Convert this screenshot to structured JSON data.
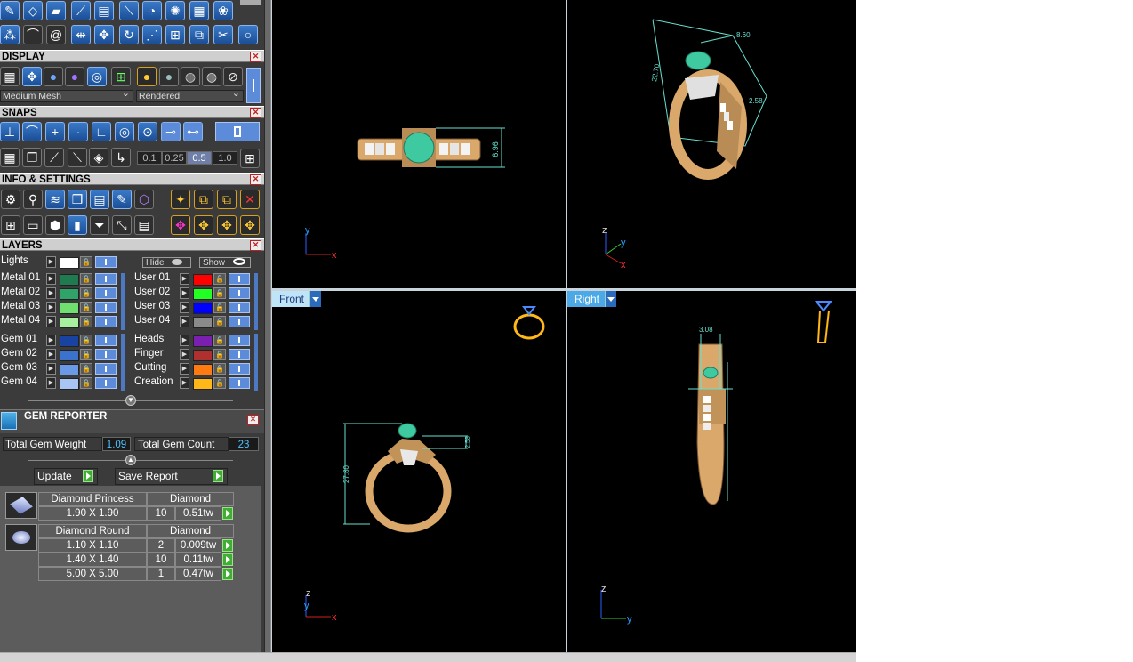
{
  "toolbar": {
    "row1_icons": [
      "sketch-icon",
      "gem-icon",
      "shape-icon",
      "sweep-icon",
      "document-icon",
      "cutter-icon",
      "bail-icon",
      "pave-icon",
      "grid-icon",
      "flower-icon"
    ],
    "row2_icons": [
      "cluster-icon",
      "curve-icon",
      "spiral-icon",
      "mirror-icon",
      "move-icon",
      "rotate-icon",
      "deform-icon",
      "link-icon",
      "split-icon",
      "scissors-icon",
      "circle-icon"
    ]
  },
  "display": {
    "title": "DISPLAY",
    "icons": [
      "wireframe-icon",
      "pin-icon",
      "sphere-blue-icon",
      "sphere-purple-icon",
      "globe-icon",
      "layout-icon",
      "sphere-gold-icon",
      "sphere-silver-icon",
      "sphere-chrome-icon",
      "sphere-glass-icon"
    ],
    "mesh_select": "Medium Mesh",
    "render_select": "Rendered"
  },
  "snaps": {
    "title": "SNAPS",
    "icons": [
      "end-snap-icon",
      "curve-snap-icon",
      "intersect-snap-icon",
      "point-snap-icon",
      "perp-snap-icon",
      "center-snap-icon",
      "circle-snap-icon",
      "mid-snap-icon",
      "near-snap-icon"
    ],
    "row2_icons": [
      "grid-snap-icon",
      "cube-snap-icon",
      "line-snap-icon",
      "ruler-icon",
      "eye-snap-icon",
      "axis-snap-icon"
    ],
    "values": [
      "0.1",
      "0.25",
      "0.5",
      "1.0"
    ],
    "selected_value": "0.5"
  },
  "info": {
    "title": "INFO & SETTINGS",
    "row1_icons": [
      "settings-icon",
      "search-icon",
      "layers-icon",
      "cube-icon",
      "script-icon",
      "edit-icon",
      "gem-info-icon",
      "magic-icon",
      "copy-icon",
      "paste-icon",
      "delete-icon"
    ],
    "row2_icons": [
      "windows-icon",
      "monitor-icon",
      "box-icon",
      "book-icon",
      "filter-icon",
      "measure-icon",
      "report-icon",
      "tool-a-icon",
      "tool-b-icon",
      "tool-c-icon",
      "tool-d-icon"
    ]
  },
  "layers": {
    "title": "LAYERS",
    "lights_label": "Lights",
    "hide_label": "Hide",
    "show_label": "Show",
    "left_group1": [
      {
        "name": "Metal 01",
        "color": "#1f7a4f"
      },
      {
        "name": "Metal 02",
        "color": "#2fa36a"
      },
      {
        "name": "Metal 03",
        "color": "#6fe06f"
      },
      {
        "name": "Metal 04",
        "color": "#a6f0a0"
      }
    ],
    "right_group1": [
      {
        "name": "User 01",
        "color": "#ff0000"
      },
      {
        "name": "User 02",
        "color": "#22ff22"
      },
      {
        "name": "User 03",
        "color": "#0000ff"
      },
      {
        "name": "User 04",
        "color": "#8a8a8a"
      }
    ],
    "left_group2": [
      {
        "name": "Gem 01",
        "color": "#1843a0"
      },
      {
        "name": "Gem 02",
        "color": "#3a72cc"
      },
      {
        "name": "Gem 03",
        "color": "#6a9ae6"
      },
      {
        "name": "Gem 04",
        "color": "#a9c5f3"
      }
    ],
    "right_group2": [
      {
        "name": "Heads",
        "color": "#7a1fb0"
      },
      {
        "name": "Finger",
        "color": "#b03030"
      },
      {
        "name": "Cutting",
        "color": "#ff7a10"
      },
      {
        "name": "Creation",
        "color": "#ffb818"
      }
    ]
  },
  "gem_reporter": {
    "title": "GEM REPORTER",
    "weight_label": "Total Gem Weight",
    "weight_value": "1.09",
    "count_label": "Total Gem Count",
    "count_value": "23",
    "update_label": "Update",
    "save_label": "Save Report",
    "groups": [
      {
        "name": "Diamond Princess",
        "material": "Diamond",
        "rows": [
          {
            "size": "1.90 X 1.90",
            "qty": "10",
            "weight": "0.51tw"
          }
        ]
      },
      {
        "name": "Diamond Round",
        "material": "Diamond",
        "rows": [
          {
            "size": "1.10 X 1.10",
            "qty": "2",
            "weight": "0.009tw"
          },
          {
            "size": "1.40 X 1.40",
            "qty": "10",
            "weight": "0.11tw"
          },
          {
            "size": "5.00 X 5.00",
            "qty": "1",
            "weight": "0.47tw"
          }
        ]
      }
    ]
  },
  "viewports": {
    "top": {
      "dim": "6.96",
      "axes": [
        "y",
        "x"
      ]
    },
    "perspective": {
      "dims": [
        "8.60",
        "22.70",
        "2.58"
      ],
      "axes": [
        "z",
        "y",
        "x"
      ]
    },
    "front": {
      "label": "Front",
      "dims": [
        "27.80",
        "2.58"
      ],
      "axes": [
        "z",
        "y",
        "x"
      ]
    },
    "right": {
      "label": "Right",
      "dims": [
        "3.08"
      ],
      "axes": [
        "z",
        "y"
      ]
    }
  },
  "colors": {
    "metal": "#d9a86a",
    "gem": "#3ec9a0",
    "dim_line": "#66e0d0",
    "accent": "#4aa9e6"
  }
}
